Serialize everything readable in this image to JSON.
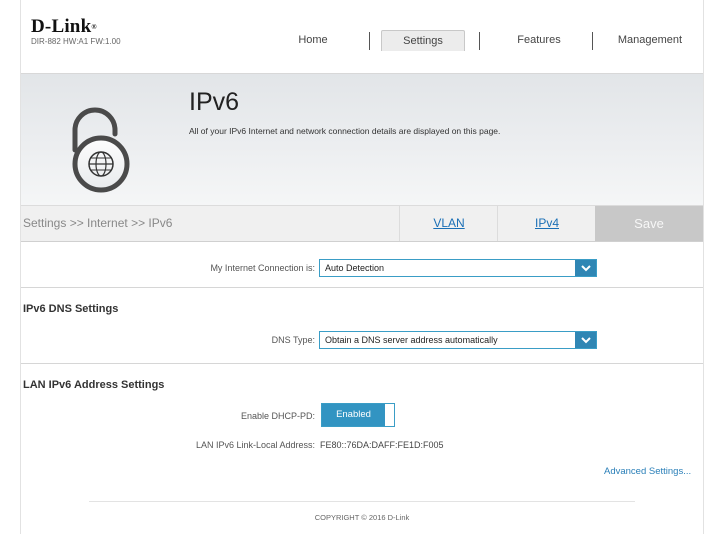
{
  "header": {
    "brand": "D-Link",
    "trademark": "®",
    "model_info": "DIR-882 HW:A1 FW:1.00",
    "nav": [
      {
        "label": "Home"
      },
      {
        "label": "Settings",
        "active": true
      },
      {
        "label": "Features"
      },
      {
        "label": "Management"
      }
    ]
  },
  "banner": {
    "title": "IPv6",
    "description": "All of your IPv6 Internet and network connection details are displayed on this page.",
    "icon": "ipv6-lock-globe-icon"
  },
  "breadcrumb": {
    "path": "Settings >> Internet >> IPv6",
    "links": [
      "VLAN",
      "IPv4"
    ],
    "save_label": "Save"
  },
  "connection": {
    "label": "My Internet Connection is:",
    "value": "Auto Detection"
  },
  "dns": {
    "section_title": "IPv6 DNS Settings",
    "label": "DNS Type:",
    "value": "Obtain a DNS server address automatically"
  },
  "lan": {
    "section_title": "LAN IPv6 Address Settings",
    "dhcp_label": "Enable DHCP-PD:",
    "dhcp_value": "Enabled",
    "link_local_label": "LAN IPv6 Link-Local Address:",
    "link_local_value": "FE80::76DA:DAFF:FE1D:F005",
    "advanced_link": "Advanced Settings..."
  },
  "footer": {
    "copyright": "COPYRIGHT © 2016 D-Link"
  },
  "colors": {
    "accent": "#3294c2",
    "link": "#1a6fb6",
    "save_bg": "#c8c8c8"
  }
}
